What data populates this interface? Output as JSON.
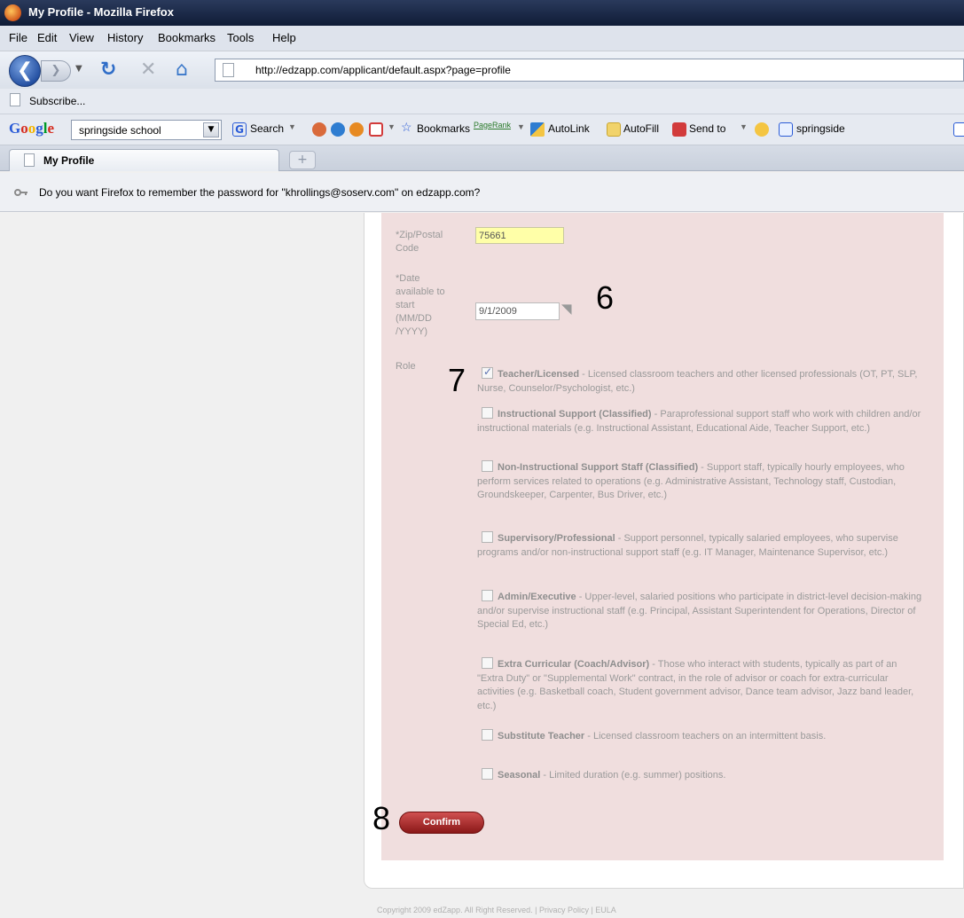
{
  "window": {
    "title": "My Profile - Mozilla Firefox"
  },
  "menu": [
    "File",
    "Edit",
    "View",
    "History",
    "Bookmarks",
    "Tools",
    "Help"
  ],
  "nav": {
    "url": "http://edzapp.com/applicant/default.aspx?page=profile"
  },
  "bookmarks": {
    "item": "Subscribe..."
  },
  "google_toolbar": {
    "logo": "Google",
    "search_value": "springside school",
    "search_label": "Search",
    "bookmarks_label": "Bookmarks",
    "pagerank_label": "PageRank",
    "autolink_label": "AutoLink",
    "autofill_label": "AutoFill",
    "sendto_label": "Send to",
    "springside_label": "springside"
  },
  "tabs": [
    {
      "label": "My Profile"
    }
  ],
  "newtab_label": "+",
  "notification": {
    "message": "Do you want Firefox to remember the password for \"khrollings@soserv.com\" on edzapp.com?"
  },
  "form": {
    "zip_label": "*Zip/Postal Code",
    "zip_value": "75661",
    "date_label": "*Date available to start (MM/DD /YYYY)",
    "date_value": "9/1/2009",
    "role_label": "Role",
    "roles": [
      {
        "name": "Teacher/Licensed",
        "desc": " - Licensed classroom teachers and other licensed professionals (OT, PT, SLP, Nurse, Counselor/Psychologist, etc.)",
        "checked": true
      },
      {
        "name": "Instructional Support (Classified)",
        "desc": " - Paraprofessional support staff who work with children and/or instructional materials (e.g. Instructional Assistant, Educational Aide, Teacher Support, etc.)",
        "checked": false
      },
      {
        "name": "Non-Instructional Support Staff (Classified)",
        "desc": " - Support staff, typically hourly employees, who perform services related to operations (e.g. Administrative Assistant, Technology staff, Custodian, Groundskeeper, Carpenter, Bus Driver, etc.)",
        "checked": false
      },
      {
        "name": "Supervisory/Professional",
        "desc": " - Support personnel, typically salaried employees, who supervise programs and/or non-instructional support staff (e.g. IT Manager, Maintenance Supervisor, etc.)",
        "checked": false
      },
      {
        "name": "Admin/Executive",
        "desc": " - Upper-level, salaried positions who participate in district-level decision-making and/or supervise instructional staff (e.g. Principal, Assistant Superintendent for Operations, Director of Special Ed, etc.)",
        "checked": false
      },
      {
        "name": "Extra Curricular (Coach/Advisor)",
        "desc": " - Those who interact with students, typically as part of an \"Extra Duty\" or \"Supplemental Work\" contract, in the role of advisor or coach for extra-curricular activities (e.g. Basketball coach, Student government advisor, Dance team advisor, Jazz band leader, etc.)",
        "checked": false
      },
      {
        "name": "Substitute Teacher",
        "desc": " - Licensed classroom teachers on an intermittent basis.",
        "checked": false
      },
      {
        "name": "Seasonal",
        "desc": " - Limited duration (e.g. summer) positions.",
        "checked": false
      }
    ],
    "confirm_label": "Confirm"
  },
  "callouts": {
    "c6": "6",
    "c7": "7",
    "c8": "8"
  },
  "footer": "Copyright 2009 edZapp. All Right Reserved. | Privacy Policy | EULA"
}
